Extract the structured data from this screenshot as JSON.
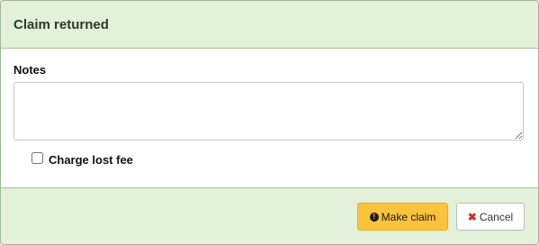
{
  "modal": {
    "title": "Claim returned",
    "notes_label": "Notes",
    "notes_value": "",
    "charge_lost_fee_label": "Charge lost fee",
    "charge_lost_fee_checked": false,
    "make_claim_label": "Make claim",
    "cancel_label": "Cancel",
    "icons": {
      "make_claim": "exclamation-circle-icon",
      "cancel": "times-icon"
    },
    "colors": {
      "header_bg": "#e3f0da",
      "primary_button": "#fbc23e",
      "cancel_icon": "#c9302c"
    }
  }
}
